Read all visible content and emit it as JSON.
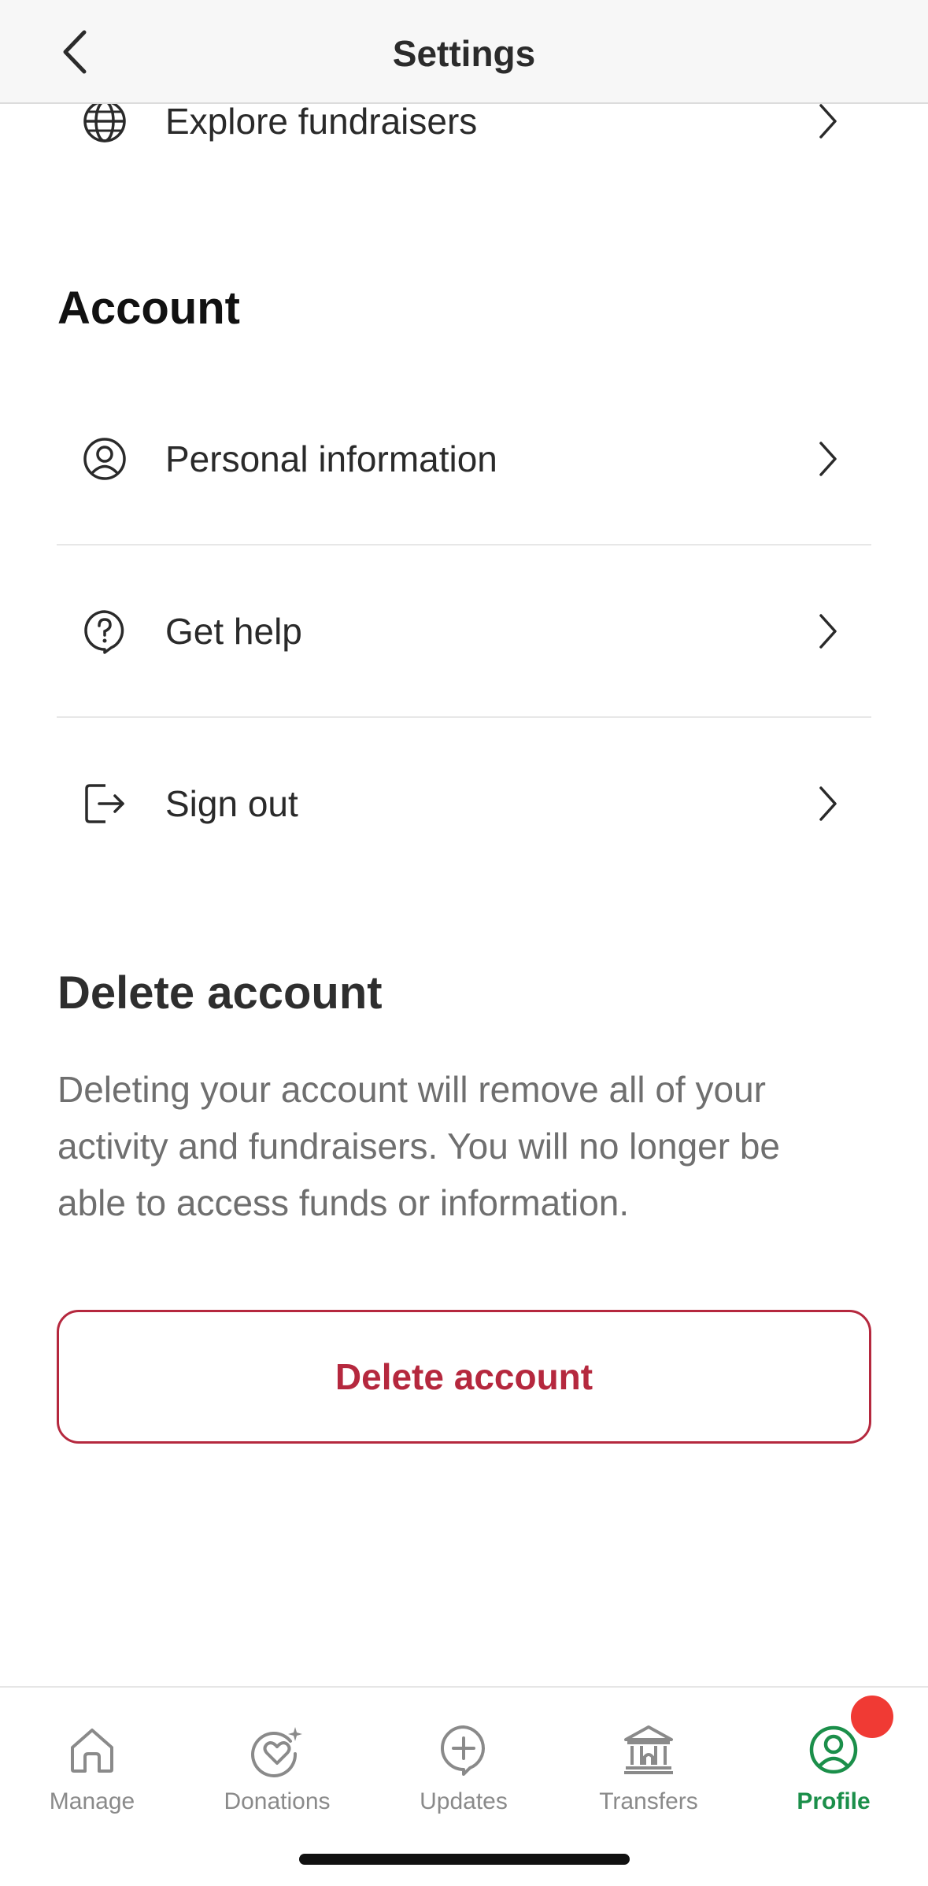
{
  "header": {
    "title": "Settings"
  },
  "top_row": {
    "label": "Explore fundraisers",
    "icon": "globe-icon"
  },
  "account": {
    "section_title": "Account",
    "items": [
      {
        "label": "Personal information",
        "icon": "user-circle-icon"
      },
      {
        "label": "Get help",
        "icon": "help-bubble-icon"
      },
      {
        "label": "Sign out",
        "icon": "sign-out-icon"
      }
    ]
  },
  "delete": {
    "section_title": "Delete account",
    "description": "Deleting your account will remove all of your activity and fundraisers. You will no longer be able to access funds or information.",
    "button_label": "Delete account",
    "button_color": "#b5283e"
  },
  "tabbar": {
    "tabs": [
      {
        "label": "Manage",
        "icon": "home-icon",
        "active": false
      },
      {
        "label": "Donations",
        "icon": "heart-sparkle-icon",
        "active": false
      },
      {
        "label": "Updates",
        "icon": "plus-bubble-icon",
        "active": false
      },
      {
        "label": "Transfers",
        "icon": "bank-icon",
        "active": false
      },
      {
        "label": "Profile",
        "icon": "profile-icon",
        "active": true
      }
    ],
    "active_color": "#1b8f4a",
    "inactive_color": "#8a8a8a",
    "notification_dot_color": "#f03a34"
  }
}
